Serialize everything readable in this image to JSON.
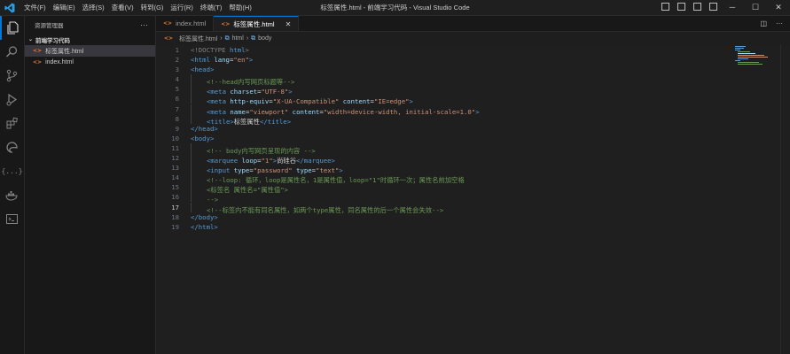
{
  "window": {
    "title": "标签属性.html - 前端学习代码 - Visual Studio Code",
    "menu": [
      "文件(F)",
      "编辑(E)",
      "选择(S)",
      "查看(V)",
      "转到(G)",
      "运行(R)",
      "终端(T)",
      "帮助(H)"
    ]
  },
  "sidebar": {
    "header": "资源管理器",
    "folder": "前端学习代码",
    "files": [
      "标签属性.html",
      "index.html"
    ]
  },
  "tabs": [
    {
      "label": "index.html"
    },
    {
      "label": "标签属性.html"
    }
  ],
  "breadcrumb": [
    "标签属性.html",
    "html",
    "body"
  ],
  "editor": {
    "current_line": 17,
    "line_numbers": [
      "1",
      "2",
      "3",
      "4",
      "5",
      "6",
      "7",
      "8",
      "9",
      "10",
      "11",
      "12",
      "13",
      "14",
      "15",
      "16",
      "17",
      "18",
      "19"
    ],
    "lines": {
      "l1": [
        "<!DOCTYPE",
        " html",
        ">"
      ],
      "l2": [
        "<html",
        " lang",
        "=",
        "\"en\"",
        ">"
      ],
      "l3": [
        "<head>"
      ],
      "l4": [
        "<!--head内写网页标题等-->"
      ],
      "l5": [
        "<meta",
        " charset",
        "=",
        "\"UTF-8\"",
        ">"
      ],
      "l6": [
        "<meta",
        " http-equiv",
        "=",
        "\"X-UA-Compatible\"",
        " content",
        "=",
        "\"IE=edge\"",
        ">"
      ],
      "l7": [
        "<meta",
        " name",
        "=",
        "\"viewport\"",
        " content",
        "=",
        "\"width=device-width, initial-scale=1.0\"",
        ">"
      ],
      "l8": [
        "<title>",
        "标签属性",
        "</title>"
      ],
      "l9": [
        "</head>"
      ],
      "l10": [
        "<body>"
      ],
      "l11": [
        "<!-- body内写网页呈现的内容 -->"
      ],
      "l12": [
        "<marquee",
        " loop",
        "=",
        "\"1\"",
        ">",
        "尚硅谷",
        "</marquee>"
      ],
      "l13": [
        "<input",
        " type",
        "=",
        "\"password\"",
        " type",
        "=",
        "\"text\"",
        ">"
      ],
      "l14": [
        "<!--loop: 循环，loop是属性名，1是属性值，loop=\"1\"时循环一次；属性名前加空格"
      ],
      "l15": [
        "<标签名 属性名=\"属性值\">"
      ],
      "l16": [
        "-->"
      ],
      "l17": [
        "<!--标签内不能有同名属性，如两个type属性，同名属性的后一个属性会失效-->"
      ],
      "l18": [
        "</body>"
      ],
      "l19": [
        "</html>"
      ]
    }
  },
  "colors": {
    "accent": "#0078d4",
    "tag": "#569cd6",
    "attribute": "#9cdcfe",
    "string": "#ce9178",
    "comment": "#6a9955",
    "html_icon": "#e37933"
  }
}
